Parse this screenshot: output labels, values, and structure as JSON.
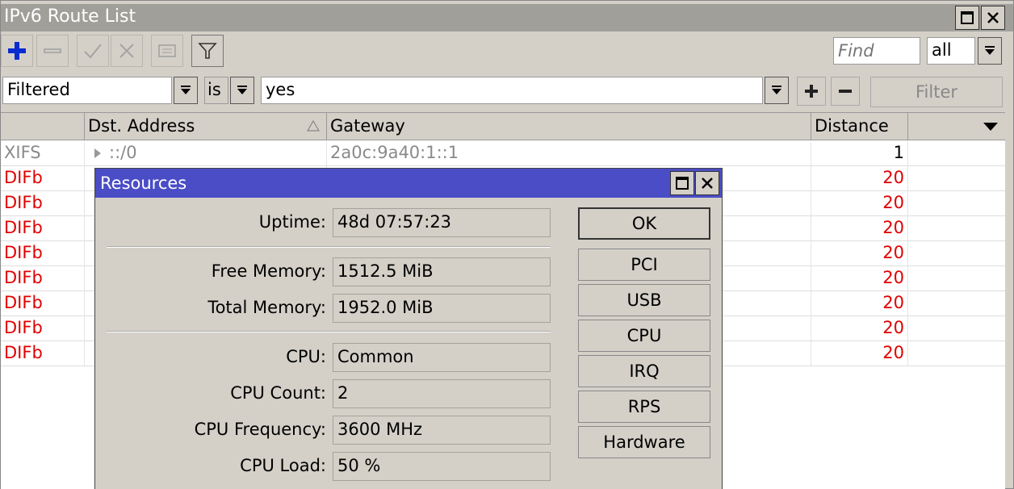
{
  "window": {
    "title": "IPv6 Route List"
  },
  "toolbar": {
    "find_placeholder": "Find",
    "scope_value": "all"
  },
  "filter": {
    "field": "Filtered",
    "operator": "is",
    "value": "yes",
    "filter_button": "Filter"
  },
  "table": {
    "columns": [
      "",
      "Dst. Address",
      "Gateway",
      "Distance"
    ],
    "rows": [
      {
        "flags": "XIFS",
        "dst": "::/0",
        "gateway": "2a0c:9a40:1::1",
        "distance": "1",
        "style": "gray"
      },
      {
        "flags": "DIFb",
        "dst": "",
        "gateway": "",
        "distance": "20",
        "style": "red"
      },
      {
        "flags": "DIFb",
        "dst": "",
        "gateway": "",
        "distance": "20",
        "style": "red"
      },
      {
        "flags": "DIFb",
        "dst": "",
        "gateway": "",
        "distance": "20",
        "style": "red"
      },
      {
        "flags": "DIFb",
        "dst": "",
        "gateway": "",
        "distance": "20",
        "style": "red"
      },
      {
        "flags": "DIFb",
        "dst": "",
        "gateway": "",
        "distance": "20",
        "style": "red"
      },
      {
        "flags": "DIFb",
        "dst": "",
        "gateway": "",
        "distance": "20",
        "style": "red"
      },
      {
        "flags": "DIFb",
        "dst": "",
        "gateway": "",
        "distance": "20",
        "style": "red"
      },
      {
        "flags": "DIFb",
        "dst": "",
        "gateway": "",
        "distance": "20",
        "style": "red"
      }
    ]
  },
  "resources": {
    "title": "Resources",
    "uptime_label": "Uptime:",
    "uptime": "48d 07:57:23",
    "free_memory_label": "Free Memory:",
    "free_memory": "1512.5 MiB",
    "total_memory_label": "Total Memory:",
    "total_memory": "1952.0 MiB",
    "cpu_label": "CPU:",
    "cpu": "Common",
    "cpu_count_label": "CPU Count:",
    "cpu_count": "2",
    "cpu_frequency_label": "CPU Frequency:",
    "cpu_frequency": "3600 MHz",
    "cpu_load_label": "CPU Load:",
    "cpu_load": "50 %",
    "buttons": {
      "ok": "OK",
      "pci": "PCI",
      "usb": "USB",
      "cpu": "CPU",
      "irq": "IRQ",
      "rps": "RPS",
      "hardware": "Hardware"
    }
  },
  "colors": {
    "dialog_title": "#4a4dc6",
    "window_title": "#a19f9a",
    "inactive_flag": "#8a8a8a",
    "dynamic_flag": "#e00000",
    "add_icon": "#0a2ccf"
  },
  "icons": [
    "add-icon",
    "remove-icon",
    "enable-icon",
    "disable-icon",
    "comment-icon",
    "filter-icon",
    "maximize-icon",
    "close-icon",
    "dropdown-arrow-icon",
    "sort-arrow-icon",
    "expand-arrow-icon"
  ]
}
